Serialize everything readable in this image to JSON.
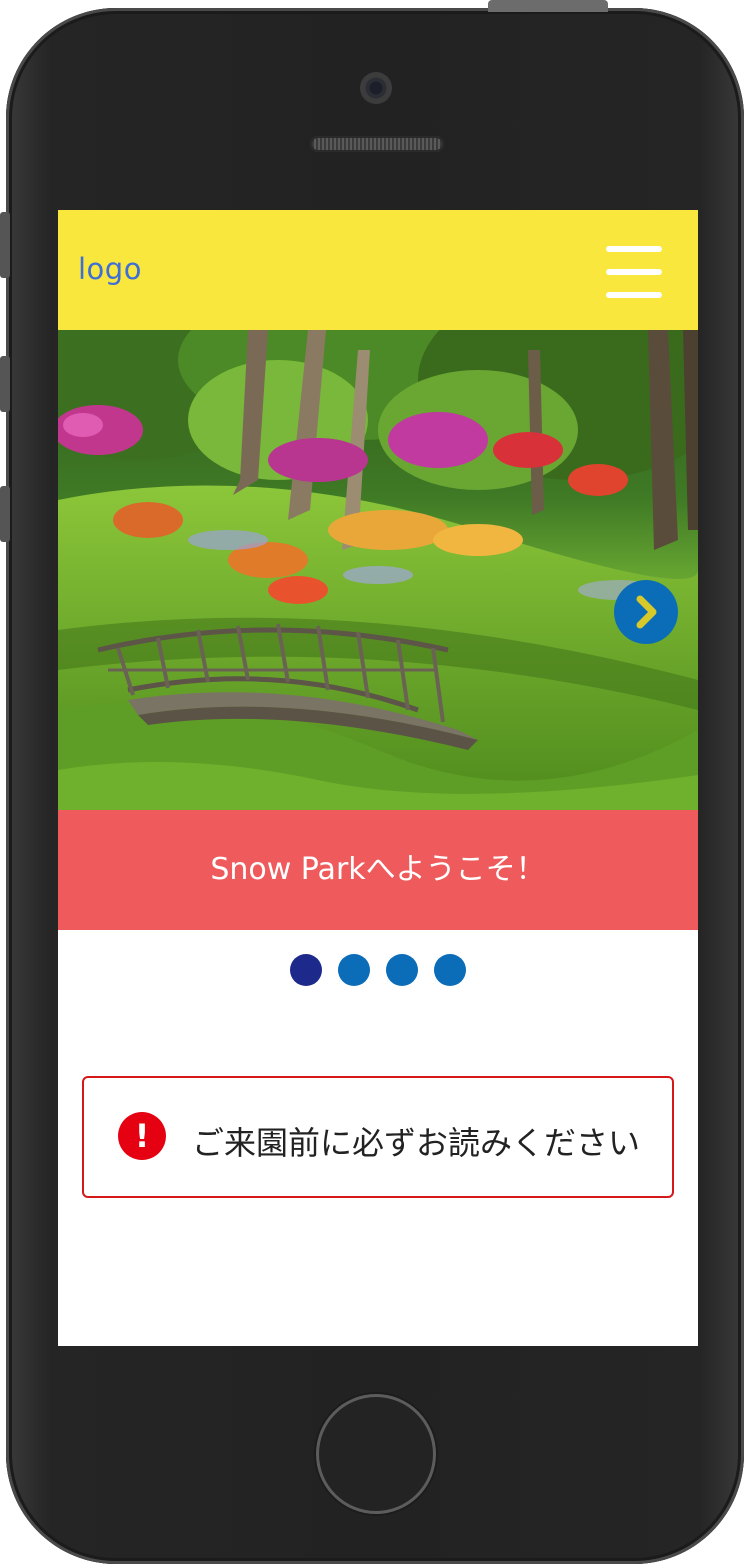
{
  "header": {
    "logo_text": "logo",
    "menu_icon": "hamburger-menu-icon",
    "background_color": "#f9e73e"
  },
  "hero": {
    "image": "park-garden-bridge-photo",
    "next_icon": "chevron-right-icon"
  },
  "caption": {
    "text": "Snow Parkへようこそ！",
    "background_color": "#ef5b5c"
  },
  "carousel": {
    "slide_count": 4,
    "active_index": 0
  },
  "notice": {
    "icon": "exclamation-icon",
    "icon_text": "!",
    "text": "ご来園前に必ずお読みください",
    "border_color": "#d51919"
  },
  "device": {
    "frame": "smartphone-frame"
  }
}
